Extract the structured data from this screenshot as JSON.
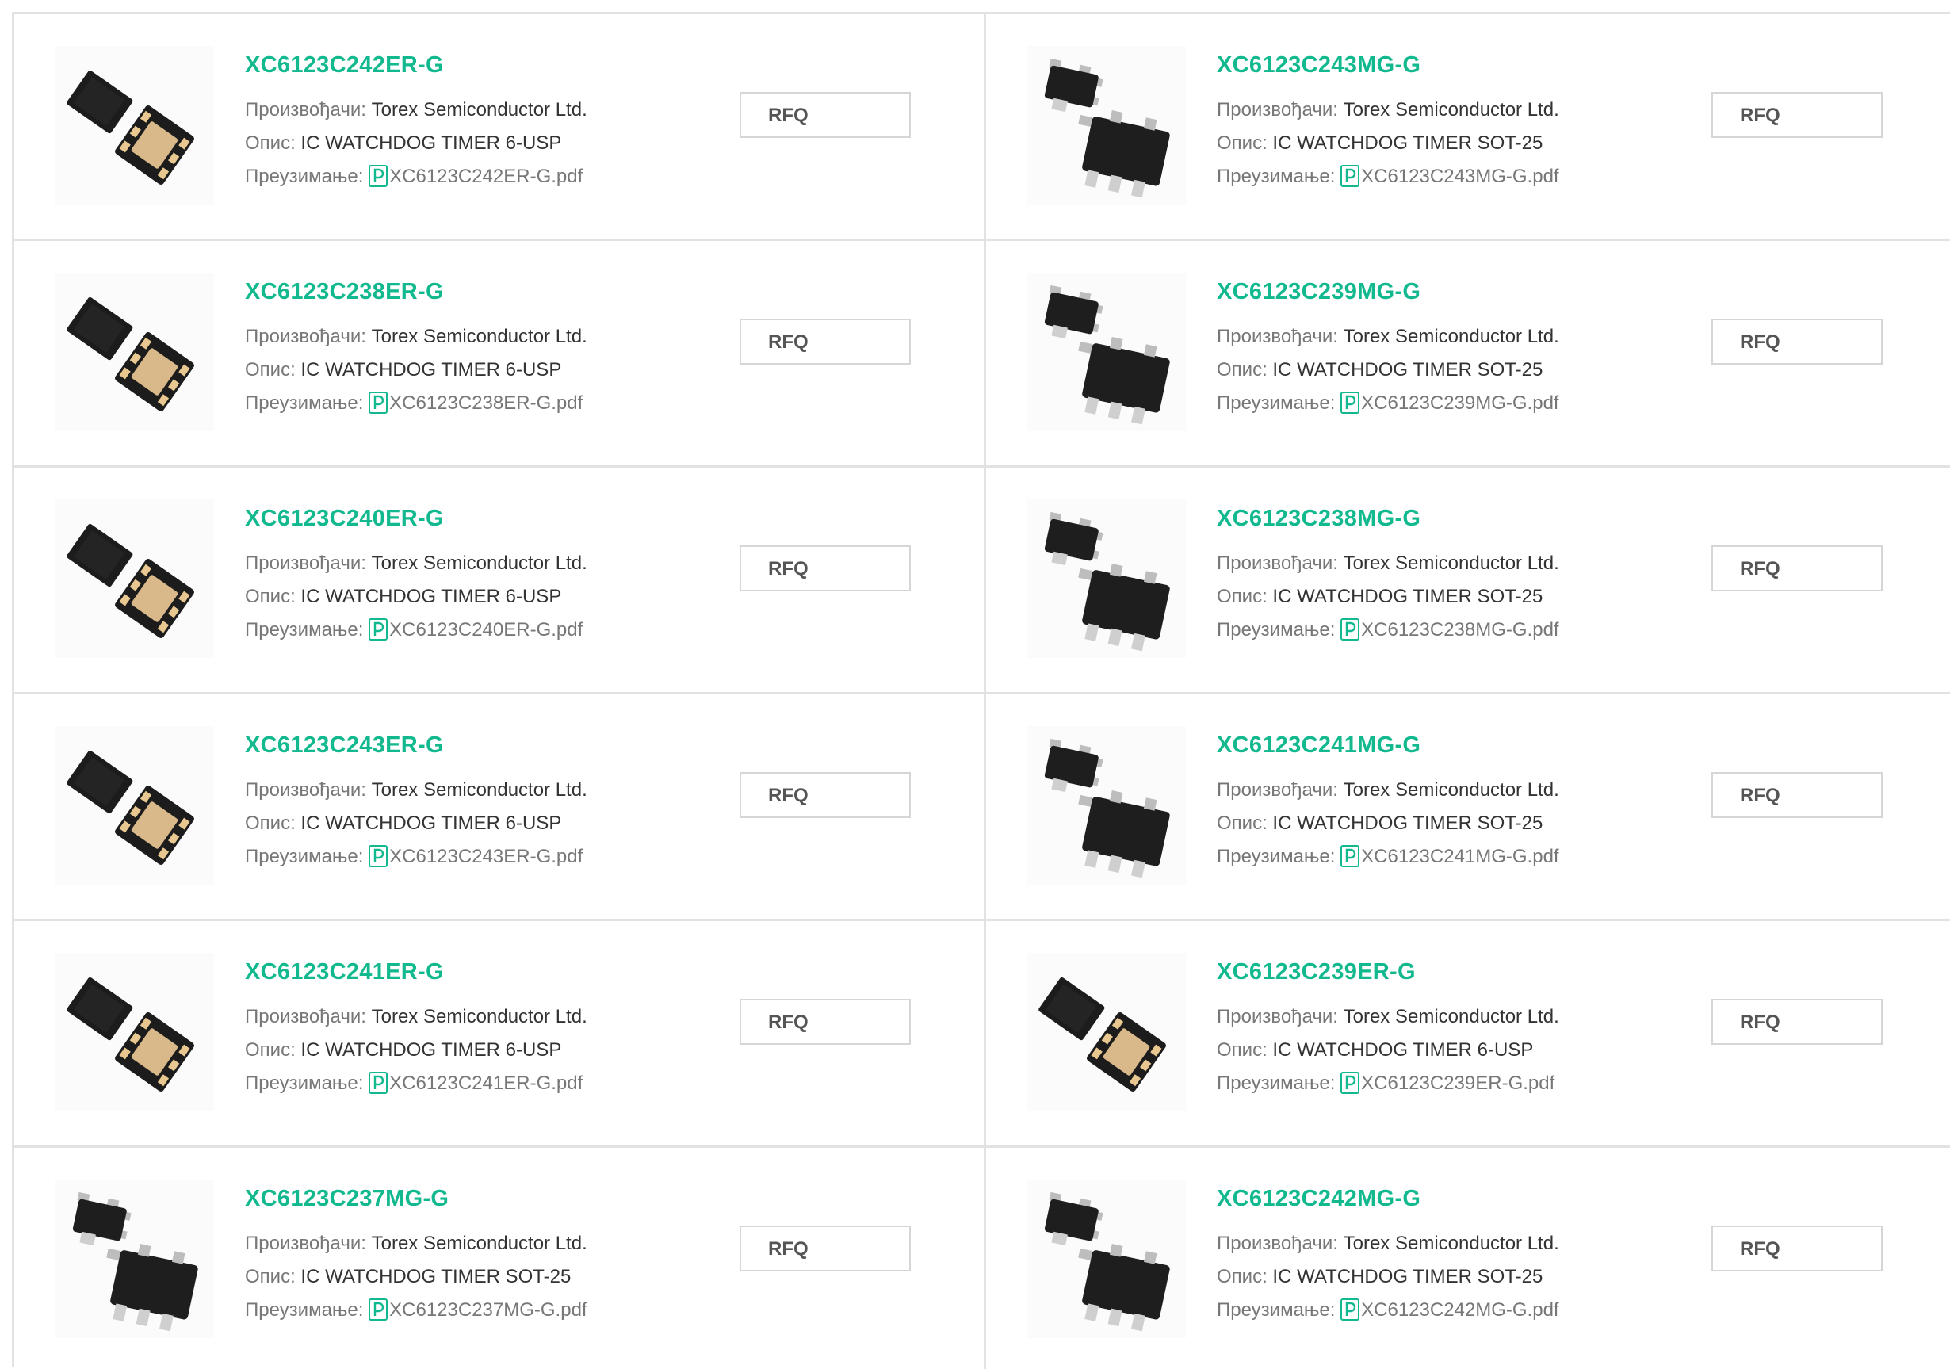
{
  "labels": {
    "manufacturer": "Произвођачи:",
    "description": "Опис:",
    "download": "Преузимање:",
    "rfq": "RFQ"
  },
  "colors": {
    "title": "#13b98e",
    "border": "#e2e2e2",
    "label": "#777777"
  },
  "products": [
    {
      "part": "XC6123C242ER-G",
      "manufacturer": "Torex Semiconductor Ltd.",
      "description": "IC WATCHDOG TIMER 6-USP",
      "pdf": "XC6123C242ER-G.pdf",
      "package": "usp"
    },
    {
      "part": "XC6123C243MG-G",
      "manufacturer": "Torex Semiconductor Ltd.",
      "description": "IC WATCHDOG TIMER SOT-25",
      "pdf": "XC6123C243MG-G.pdf",
      "package": "sot"
    },
    {
      "part": "XC6123C238ER-G",
      "manufacturer": "Torex Semiconductor Ltd.",
      "description": "IC WATCHDOG TIMER 6-USP",
      "pdf": "XC6123C238ER-G.pdf",
      "package": "usp"
    },
    {
      "part": "XC6123C239MG-G",
      "manufacturer": "Torex Semiconductor Ltd.",
      "description": "IC WATCHDOG TIMER SOT-25",
      "pdf": "XC6123C239MG-G.pdf",
      "package": "sot"
    },
    {
      "part": "XC6123C240ER-G",
      "manufacturer": "Torex Semiconductor Ltd.",
      "description": "IC WATCHDOG TIMER 6-USP",
      "pdf": "XC6123C240ER-G.pdf",
      "package": "usp"
    },
    {
      "part": "XC6123C238MG-G",
      "manufacturer": "Torex Semiconductor Ltd.",
      "description": "IC WATCHDOG TIMER SOT-25",
      "pdf": "XC6123C238MG-G.pdf",
      "package": "sot"
    },
    {
      "part": "XC6123C243ER-G",
      "manufacturer": "Torex Semiconductor Ltd.",
      "description": "IC WATCHDOG TIMER 6-USP",
      "pdf": "XC6123C243ER-G.pdf",
      "package": "usp"
    },
    {
      "part": "XC6123C241MG-G",
      "manufacturer": "Torex Semiconductor Ltd.",
      "description": "IC WATCHDOG TIMER SOT-25",
      "pdf": "XC6123C241MG-G.pdf",
      "package": "sot"
    },
    {
      "part": "XC6123C241ER-G",
      "manufacturer": "Torex Semiconductor Ltd.",
      "description": "IC WATCHDOG TIMER 6-USP",
      "pdf": "XC6123C241ER-G.pdf",
      "package": "usp"
    },
    {
      "part": "XC6123C239ER-G",
      "manufacturer": "Torex Semiconductor Ltd.",
      "description": "IC WATCHDOG TIMER 6-USP",
      "pdf": "XC6123C239ER-G.pdf",
      "package": "usp"
    },
    {
      "part": "XC6123C237MG-G",
      "manufacturer": "Torex Semiconductor Ltd.",
      "description": "IC WATCHDOG TIMER SOT-25",
      "pdf": "XC6123C237MG-G.pdf",
      "package": "sot"
    },
    {
      "part": "XC6123C242MG-G",
      "manufacturer": "Torex Semiconductor Ltd.",
      "description": "IC WATCHDOG TIMER SOT-25",
      "pdf": "XC6123C242MG-G.pdf",
      "package": "sot"
    }
  ]
}
